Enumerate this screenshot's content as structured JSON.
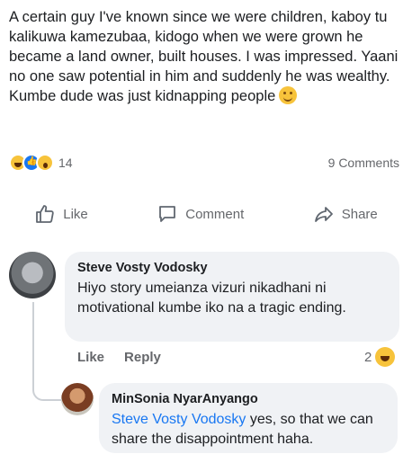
{
  "post": {
    "text": "A certain guy I've known since we were children, kaboy tu kalikuwa kamezubaa, kidogo when we were grown he became a land owner, built houses. I was impressed. Yaani no one saw potential in him and suddenly he was wealthy. Kumbe dude was just kidnapping people",
    "reaction_count": "14",
    "comment_count": "9 Comments"
  },
  "actions": {
    "like": "Like",
    "comment": "Comment",
    "share": "Share"
  },
  "comments": [
    {
      "author": "Steve Vosty Vodosky",
      "text": "Hiyo story umeianza vizuri nikadhani ni motivational kumbe iko na a tragic ending.",
      "like_label": "Like",
      "reply_label": "Reply",
      "reaction_count": "2"
    },
    {
      "author": "MinSonia NyarAnyango",
      "mention": "Steve Vosty Vodosky",
      "text": " yes, so that we can share the disappointment haha."
    }
  ],
  "icons": {
    "reactions": [
      "haha-reaction-icon",
      "like-reaction-icon",
      "wow-reaction-icon"
    ],
    "like": "thumbs-up-icon",
    "comment": "comment-bubble-icon",
    "share": "share-arrow-icon"
  },
  "colors": {
    "link": "#1877f2",
    "muted": "#65676b",
    "bubble": "#f0f2f5"
  }
}
